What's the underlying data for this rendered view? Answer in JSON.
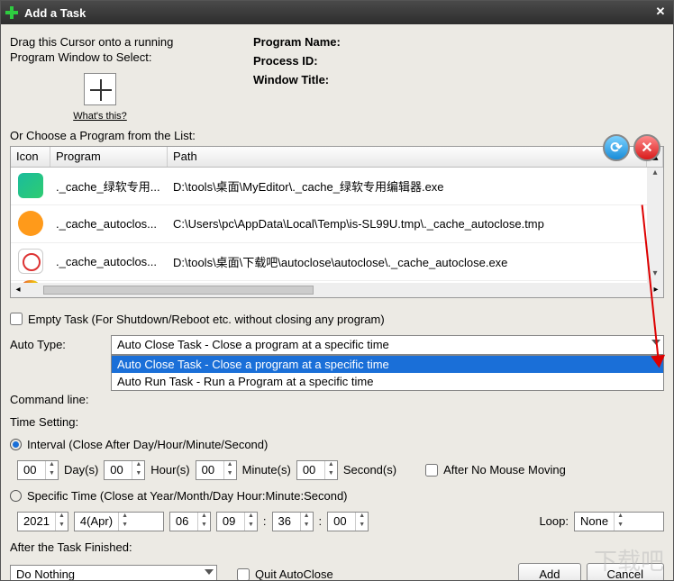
{
  "titlebar": {
    "title": "Add a Task"
  },
  "drag": {
    "text1": "Drag this Cursor onto a running",
    "text2": "Program Window to Select:",
    "whats": "What's this?"
  },
  "proglabels": {
    "name": "Program Name:",
    "pid": "Process ID:",
    "wt": "Window Title:"
  },
  "chooselabel": "Or Choose a Program from the List:",
  "columns": {
    "icon": "Icon",
    "prog": "Program",
    "path": "Path"
  },
  "rows": [
    {
      "iconCls": "clock",
      "prog": "._cache_autoclos...",
      "path": "D:\\tools\\桌面\\下载吧\\autoclose\\autoclose\\._cache_autoclose.exe"
    },
    {
      "iconCls": "bell",
      "prog": "._cache_autoclos...",
      "path": "C:\\Users\\pc\\AppData\\Local\\Temp\\is-SL99U.tmp\\._cache_autoclose.tmp"
    },
    {
      "iconCls": "r",
      "prog": "._cache_绿软专用...",
      "path": "D:\\tools\\桌面\\MyEditor\\._cache_绿软专用编辑器.exe"
    }
  ],
  "emptyTask": "Empty Task (For Shutdown/Reboot etc. without closing any program)",
  "autoTypeLabel": "Auto Type:",
  "autoType": {
    "value": "Auto Close Task - Close a program at a specific time",
    "options": [
      "Auto Close Task - Close a program at a specific time",
      "Auto Run Task - Run a Program at a specific time"
    ]
  },
  "cmdLabel": "Command line:",
  "timeSettingLabel": "Time Setting:",
  "intervalLabel": "Interval (Close After Day/Hour/Minute/Second)",
  "interval": {
    "day": "00",
    "dayL": "Day(s)",
    "hour": "00",
    "hourL": "Hour(s)",
    "min": "00",
    "minL": "Minute(s)",
    "sec": "00",
    "secL": "Second(s)"
  },
  "afterNoMouse": "After No Mouse Moving",
  "specificLabel": "Specific Time (Close at Year/Month/Day Hour:Minute:Second)",
  "specific": {
    "year": "2021",
    "month": "4(Apr)",
    "day": "06",
    "hour": "09",
    "minute": "36",
    "second": "00"
  },
  "loopLabel": "Loop:",
  "loopValue": "None",
  "afterFinishLabel": "After the Task Finished:",
  "afterFinishValue": "Do Nothing",
  "quitLabel": "Quit AutoClose",
  "addBtn": "Add",
  "cancelBtn": "Cancel",
  "watermark": "下载吧"
}
